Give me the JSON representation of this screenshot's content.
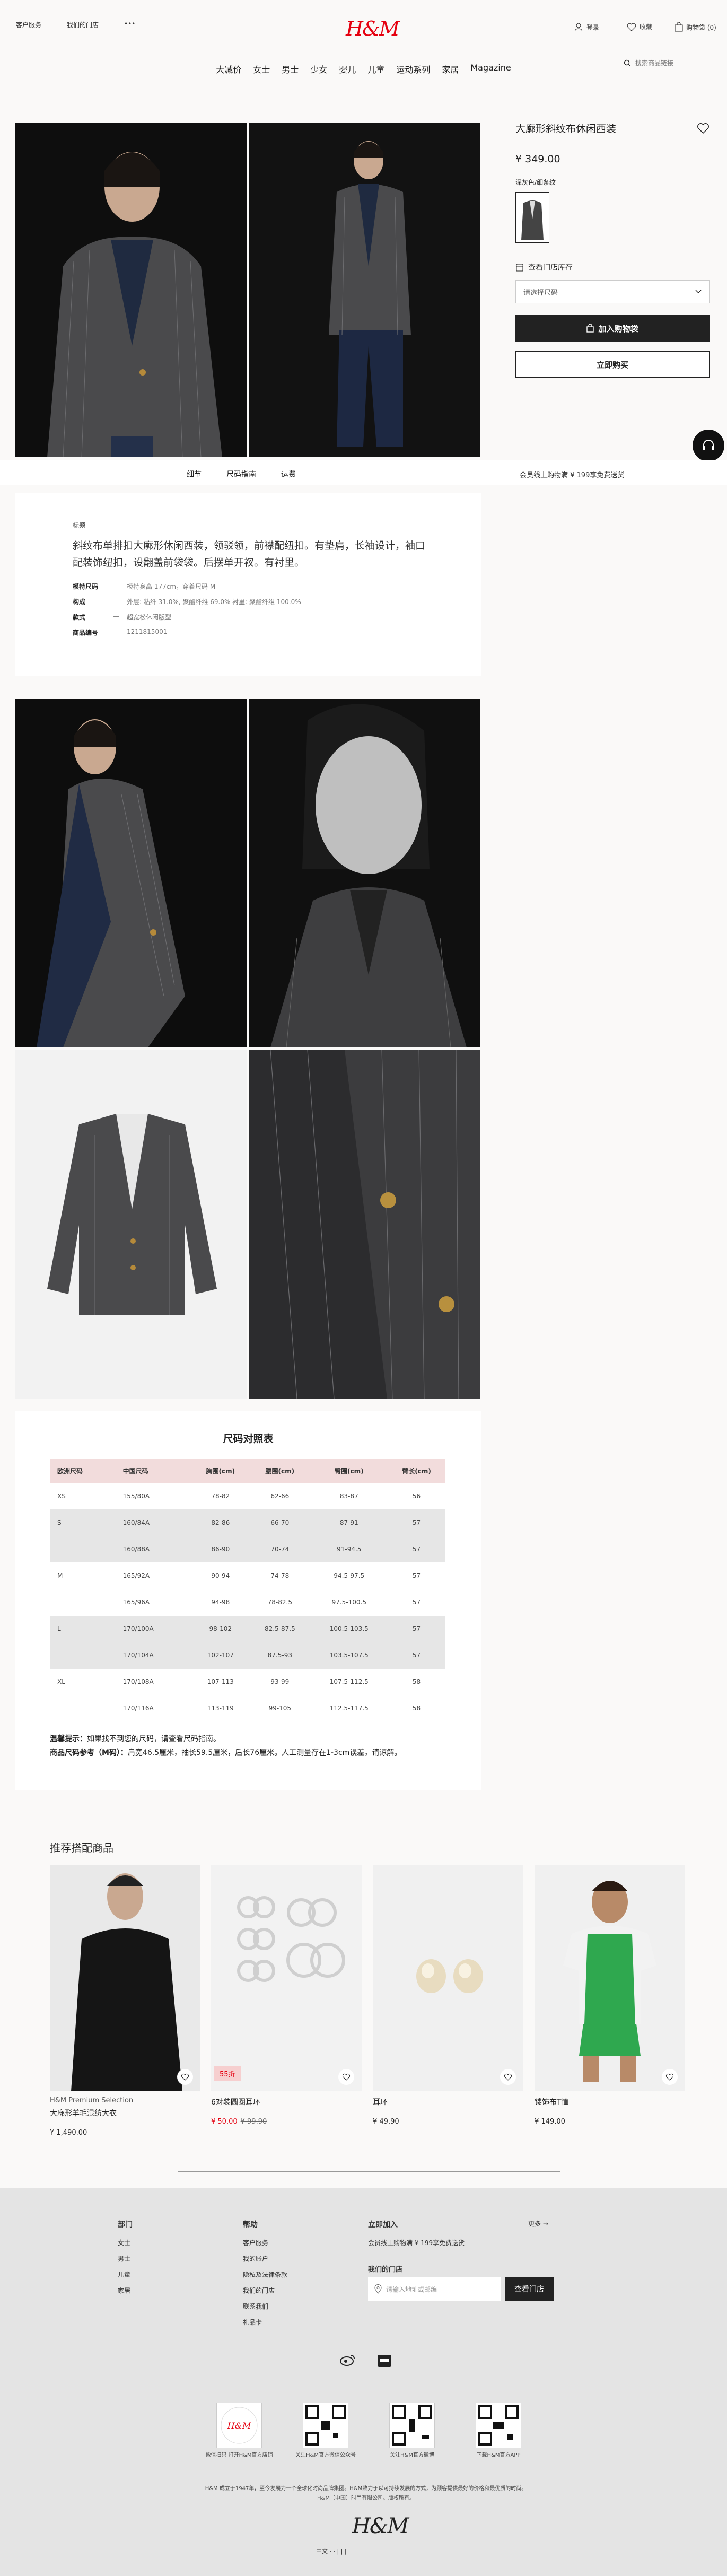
{
  "header": {
    "top_left": [
      "客户服务",
      "我们的门店",
      "•••"
    ],
    "logo": "H&M",
    "top_right": {
      "login": "登录",
      "favorites": "收藏",
      "cart": "购物袋 (0)"
    },
    "nav": [
      "大减价",
      "女士",
      "男士",
      "少女",
      "婴儿",
      "儿童",
      "运动系列",
      "家居",
      "Magazine"
    ],
    "search_placeholder": "搜索商品链接"
  },
  "product": {
    "title": "大廓形斜纹布休闲西装",
    "price": "¥ 349.00",
    "color_label": "深灰色/细条纹",
    "store_stock": "查看门店库存",
    "size_placeholder": "请选择尺码",
    "add_to_bag": "加入购物袋",
    "buy_now": "立即购买"
  },
  "tabbar": {
    "tabs": [
      "细节",
      "尺码指南",
      "运费"
    ],
    "shipping_note": "会员线上购物满 ¥ 199享免费送货"
  },
  "description": {
    "label": "标题",
    "text": "斜纹布单排扣大廓形休闲西装，领驳领，前襟配纽扣。有垫肩，长袖设计，袖口配装饰纽扣，设翻盖前袋袋。后摆单开衩。有衬里。",
    "rows": [
      {
        "k": "模特尺码",
        "v": "模特身高 177cm，穿着尺码 M"
      },
      {
        "k": "构成",
        "v": "外层: 粘纤 31.0%, 聚酯纤维 69.0%  衬里: 聚酯纤维 100.0%"
      },
      {
        "k": "款式",
        "v": "超宽松休闲版型"
      },
      {
        "k": "商品编号",
        "v": "1211815001"
      }
    ]
  },
  "size_chart": {
    "title": "尺码对照表",
    "headers": [
      "欧洲尺码",
      "中国尺码",
      "胸围(cm)",
      "腰围(cm)",
      "臀围(cm)",
      "臂长(cm)"
    ],
    "rows": [
      {
        "eu": "XS",
        "cn": "155/80A",
        "chest": "78-82",
        "waist": "62-66",
        "hip": "83-87",
        "arm": "56",
        "shade": false
      },
      {
        "eu": "S",
        "cn": "160/84A",
        "chest": "82-86",
        "waist": "66-70",
        "hip": "87-91",
        "arm": "57",
        "shade": true
      },
      {
        "eu": "",
        "cn": "160/88A",
        "chest": "86-90",
        "waist": "70-74",
        "hip": "91-94.5",
        "arm": "57",
        "shade": true
      },
      {
        "eu": "M",
        "cn": "165/92A",
        "chest": "90-94",
        "waist": "74-78",
        "hip": "94.5-97.5",
        "arm": "57",
        "shade": false
      },
      {
        "eu": "",
        "cn": "165/96A",
        "chest": "94-98",
        "waist": "78-82.5",
        "hip": "97.5-100.5",
        "arm": "57",
        "shade": false
      },
      {
        "eu": "L",
        "cn": "170/100A",
        "chest": "98-102",
        "waist": "82.5-87.5",
        "hip": "100.5-103.5",
        "arm": "57",
        "shade": true
      },
      {
        "eu": "",
        "cn": "170/104A",
        "chest": "102-107",
        "waist": "87.5-93",
        "hip": "103.5-107.5",
        "arm": "57",
        "shade": true
      },
      {
        "eu": "XL",
        "cn": "170/108A",
        "chest": "107-113",
        "waist": "93-99",
        "hip": "107.5-112.5",
        "arm": "58",
        "shade": false
      },
      {
        "eu": "",
        "cn": "170/116A",
        "chest": "113-119",
        "waist": "99-105",
        "hip": "112.5-117.5",
        "arm": "58",
        "shade": false
      }
    ],
    "note1_label": "温馨提示：",
    "note1": "如果找不到您的尺码，请查看尺码指南。",
    "note2_label": "商品尺码参考（M码）：",
    "note2": "肩宽46.5厘米，袖长59.5厘米，后长76厘米。人工测量存在1-3cm误差，请谅解。"
  },
  "recommend": {
    "title": "推荐搭配商品",
    "items": [
      {
        "brand": "H&M Premium Selection",
        "name": "大廓形羊毛混纺大衣",
        "price": "¥ 1,490.00",
        "old": "",
        "badge": ""
      },
      {
        "brand": "",
        "name": "6对装圆圈耳环",
        "price": "¥ 50.00",
        "old": "¥ 99.90",
        "badge": "55折"
      },
      {
        "brand": "",
        "name": "耳环",
        "price": "¥ 49.90",
        "old": "",
        "badge": ""
      },
      {
        "brand": "",
        "name": "镂饰布T恤",
        "price": "¥ 149.00",
        "old": "",
        "badge": ""
      }
    ]
  },
  "footer": {
    "col1": {
      "h": "部门",
      "items": [
        "女士",
        "男士",
        "儿童",
        "家居"
      ]
    },
    "col2": {
      "h": "帮助",
      "items": [
        "客户服务",
        "我的账户",
        "隐私及法律条款",
        "我们的门店",
        "联系我们",
        "礼品卡"
      ]
    },
    "col3": {
      "h": "立即加入",
      "text": "会员线上购物满 ¥ 199享免费送货"
    },
    "more": "更多 →",
    "find_store": "我们的门店",
    "store_placeholder": "请输入地址或邮编",
    "find_btn": "查看门店",
    "qr": [
      "微信扫码 打开H&M官方店铺",
      "关注H&M官方微信公众号",
      "关注H&M官方微博",
      "下载H&M官方APP"
    ],
    "legal": "H&M 成立于1947年，至今发展为一个全球化时尚品牌集团。H&M致力于以可持续发展的方式，为顾客提供最好的价格和最优质的时尚。H&M（中国）时尚有限公司。版权所有。",
    "logo": "H&M",
    "lang": "中文  ·  ·  |  |  |"
  },
  "colors": {
    "brand": "#e50010",
    "dark": "#222222",
    "sale_badge": "#f6cfcf"
  }
}
